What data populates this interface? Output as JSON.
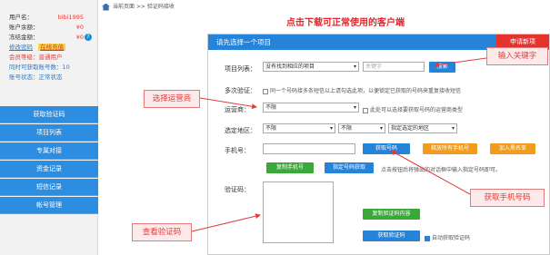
{
  "sidebar": {
    "info": {
      "username_label": "用户名：",
      "username": "bibi1995",
      "balance_label": "账户余额：",
      "balance": "¥0",
      "frozen_label": "冻结金额：",
      "frozen": "¥0",
      "change_password": "修改密码",
      "recharge": "在线充值",
      "member_level": "会员等级：普通用户",
      "concurrent": "同时可获取账号数：10",
      "account_status": "账号状态：正常状态"
    },
    "menu": [
      "获取验证码",
      "项目列表",
      "专属对接",
      "资金记录",
      "短信记录",
      "帐号管理"
    ]
  },
  "breadcrumb": "当前页面 >> 验证码接收",
  "headline": "点击下载可正常使用的客户端",
  "panel": {
    "title": "请先选择一个项目",
    "apply_button": "申请新项",
    "project_label": "项目列表：",
    "project_select": "没有找到相应的项目",
    "keyword_placeholder": "关键字",
    "search_button": "搜索",
    "multi_label": "多次验证：",
    "multi_text": "同一个号码接多条短信以上请勾选此项，以便锁定已获取的号码来重复接收短信",
    "carrier_label": "运营商：",
    "carrier_select": "不限",
    "carrier_hint": "此处可以选择要获取号码的运营商类型",
    "region_label": "选定地区：",
    "region_select_1": "不限",
    "region_select_2": "不限",
    "region_select_3": "指定选定的地区",
    "phone_label": "手机号：",
    "get_number_button": "获取号码",
    "release_all_button": "释放所有手机号",
    "blacklist_button": "加入黑名单",
    "copy_phone_button": "复制手机号",
    "specify_get_button": "指定号码获取",
    "specify_hint": "点击按钮后将弹出的对话框中输入指定号码即可。",
    "code_label": "验证码：",
    "copy_code_button": "复制验证码内容",
    "get_code_button": "获取验证码",
    "auto_get_label": "自动获取验证码"
  },
  "callouts": {
    "keyword": "输入关键字",
    "carrier": "选择运营商",
    "get_phone": "获取手机号码",
    "view_code": "查看验证码"
  }
}
